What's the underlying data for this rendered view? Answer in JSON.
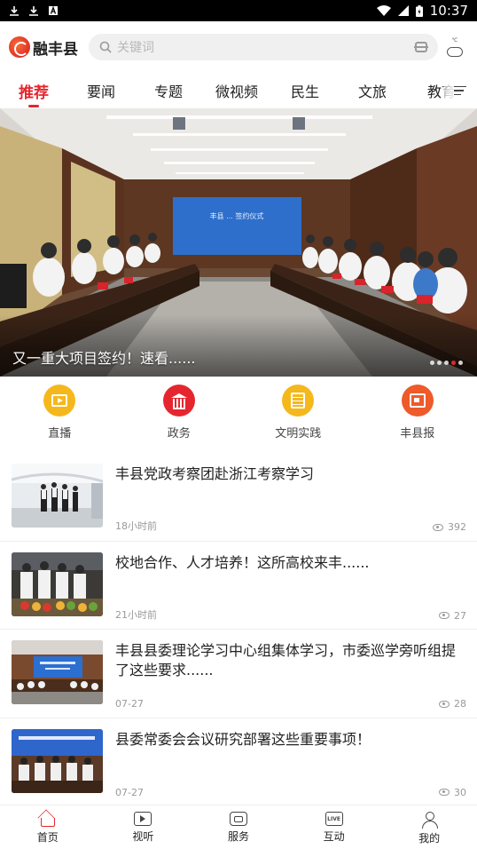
{
  "status_bar": {
    "time": "10:37"
  },
  "header": {
    "app_name": "融丰县",
    "search_placeholder": "关键词",
    "weather_label": "℃"
  },
  "tabs": [
    {
      "label": "推荐",
      "active": true
    },
    {
      "label": "要闻"
    },
    {
      "label": "专题"
    },
    {
      "label": "微视频"
    },
    {
      "label": "民生"
    },
    {
      "label": "文旅"
    },
    {
      "label": "教育"
    }
  ],
  "banner": {
    "caption": "又一重大项目签约！速看......",
    "screen_text": "丰县 ... 签约仪式",
    "slide_count": 5,
    "active_slide": 4
  },
  "quick_entries": [
    {
      "label": "直播",
      "icon": "tv-icon",
      "color": "#f5b81c"
    },
    {
      "label": "政务",
      "icon": "government-icon",
      "color": "#e6262e"
    },
    {
      "label": "文明实践",
      "icon": "document-icon",
      "color": "#f5b81c"
    },
    {
      "label": "丰县报",
      "icon": "newspaper-icon",
      "color": "#ee5a2a"
    }
  ],
  "news": [
    {
      "title": "丰县党政考察团赴浙江考察学习",
      "time": "18小时前",
      "views": "392"
    },
    {
      "title": "校地合作、人才培养！这所高校来丰......",
      "time": "21小时前",
      "views": "27"
    },
    {
      "title": "丰县县委理论学习中心组集体学习，市委巡学旁听组提了这些要求......",
      "time": "07-27",
      "views": "28"
    },
    {
      "title": "县委常委会会议研究部署这些重要事项！",
      "time": "07-27",
      "views": "30"
    }
  ],
  "bottom_nav": [
    {
      "label": "首页",
      "icon": "home-icon",
      "active": true
    },
    {
      "label": "视听",
      "icon": "video-icon"
    },
    {
      "label": "服务",
      "icon": "service-icon"
    },
    {
      "label": "互动",
      "icon": "live-icon",
      "icon_text": "LIVE"
    },
    {
      "label": "我的",
      "icon": "profile-icon"
    }
  ],
  "colors": {
    "accent": "#e6262e",
    "yellow": "#f5b81c",
    "orange": "#ee5a2a"
  }
}
